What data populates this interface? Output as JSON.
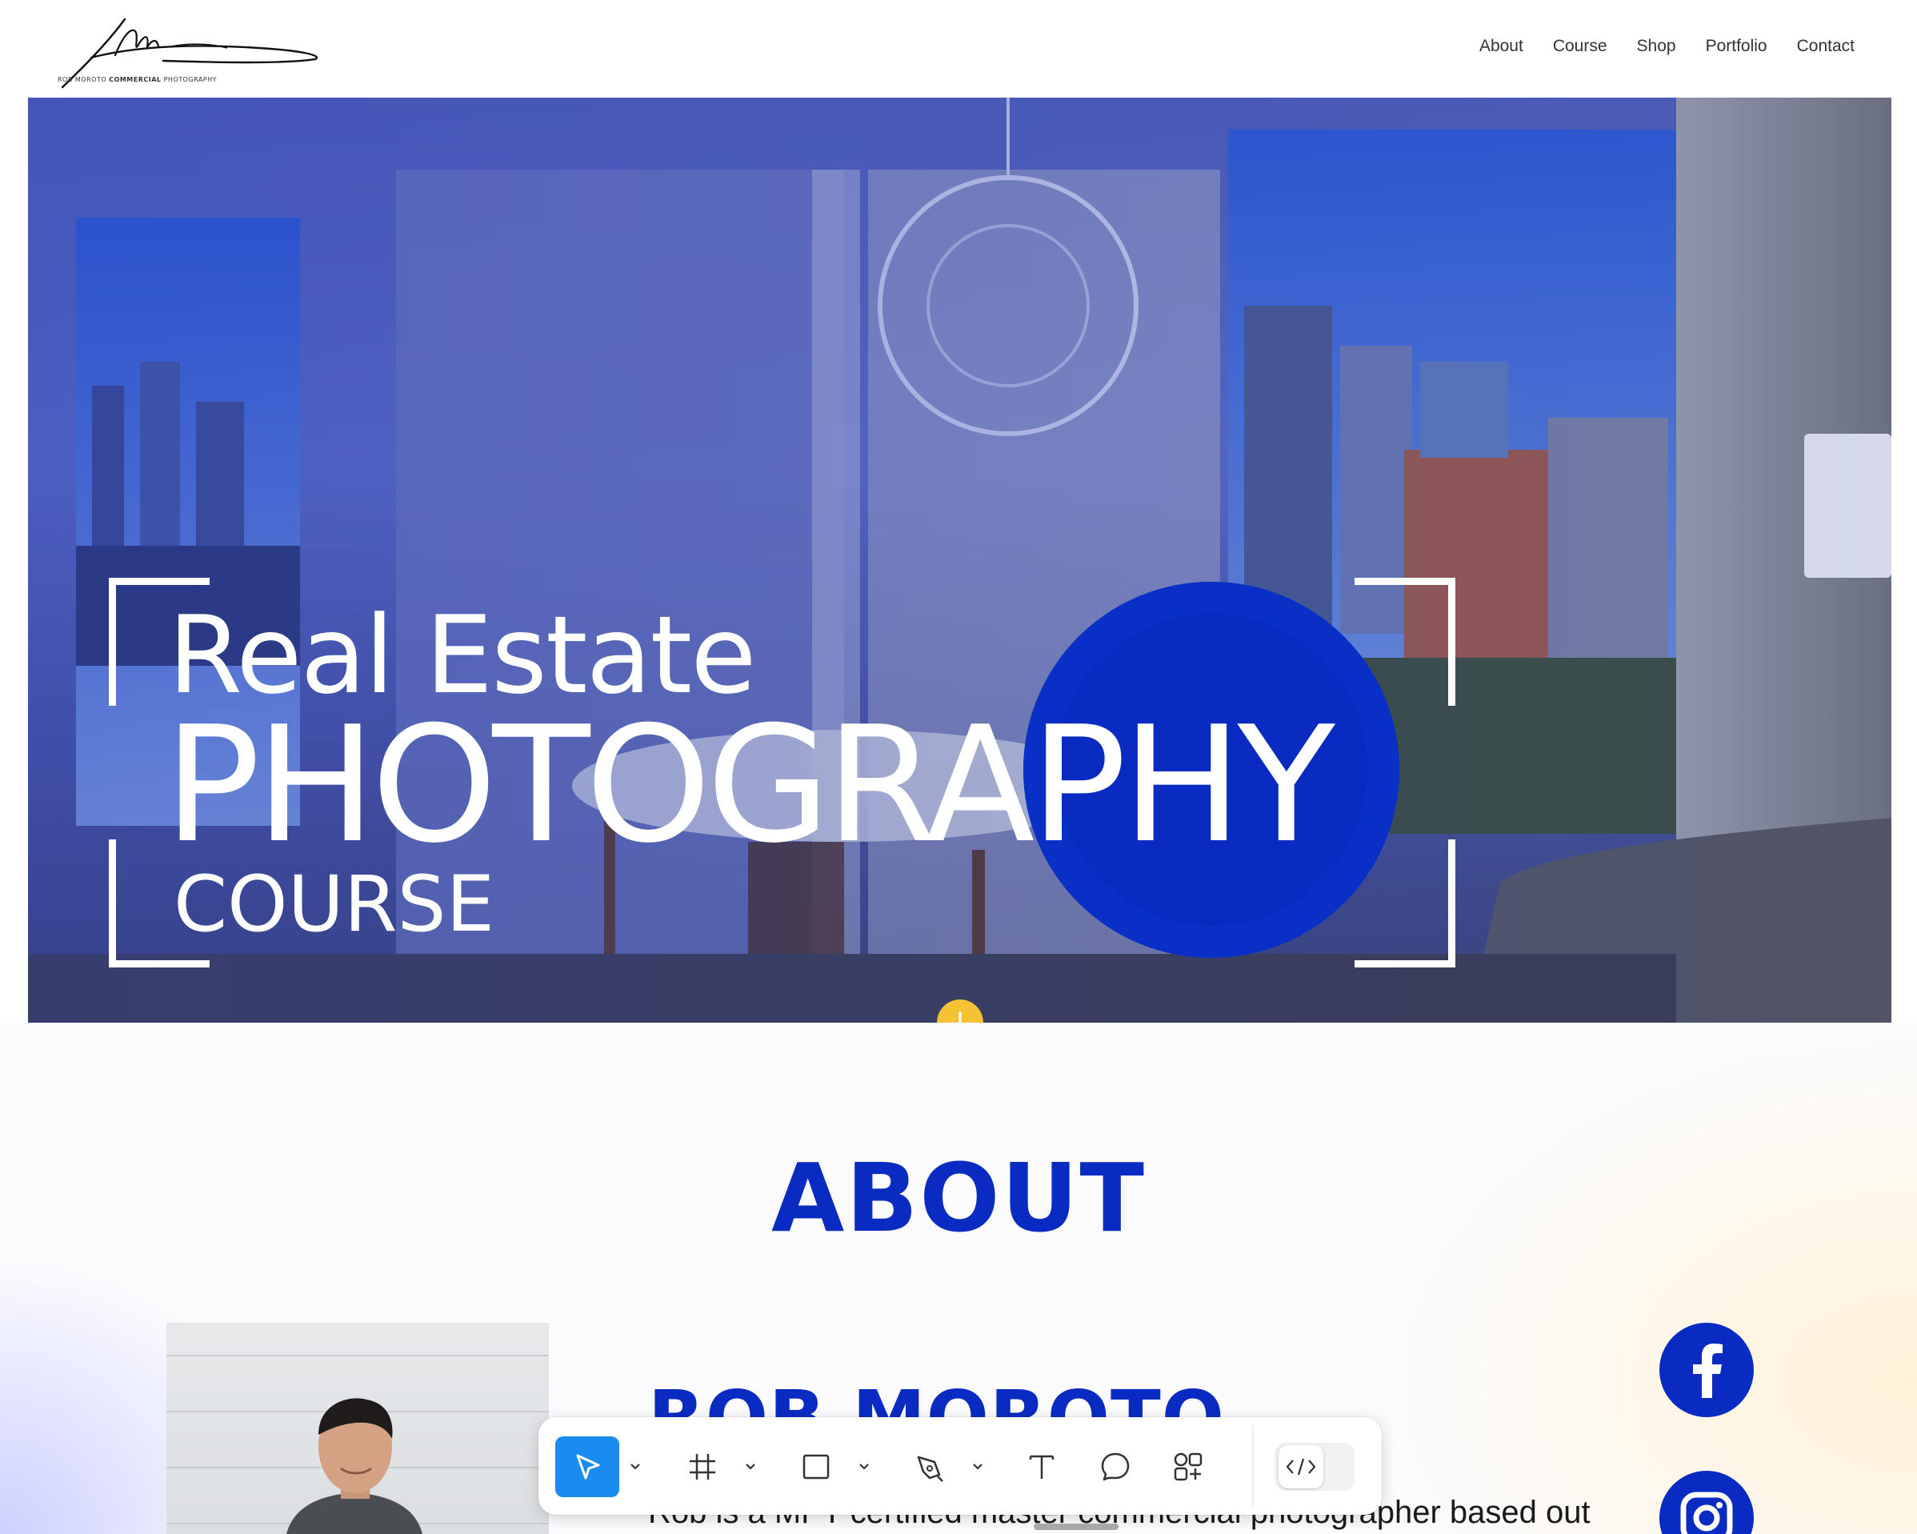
{
  "header": {
    "logo_caption_pre": "ROB MOROTO ",
    "logo_caption_bold": "COMMERCIAL",
    "logo_caption_post": " PHOTOGRAPHY",
    "nav": [
      "About",
      "Course",
      "Shop",
      "Portfolio",
      "Contact"
    ]
  },
  "hero": {
    "line1": "Real Estate",
    "line2": "PHOTOGRAPHY",
    "line3": "COURSE",
    "scroll_icon": "arrow-down-circle-icon"
  },
  "about": {
    "title": "ABOUT",
    "name": "ROB MOROTO",
    "bio": "Rob is a MPT certified master commercial photographer based out",
    "social": [
      "facebook-icon",
      "instagram-icon"
    ]
  },
  "toolbar": {
    "tools": [
      "pointer-icon",
      "frame-icon",
      "rectangle-icon",
      "pen-icon",
      "text-icon",
      "comment-icon",
      "components-icon"
    ],
    "active": "pointer-icon",
    "extra": "code-icon"
  },
  "colors": {
    "brand_blue": "#0a2bc1",
    "accent_yellow": "#f4c232",
    "toolbar_active": "#1a8cf0"
  }
}
